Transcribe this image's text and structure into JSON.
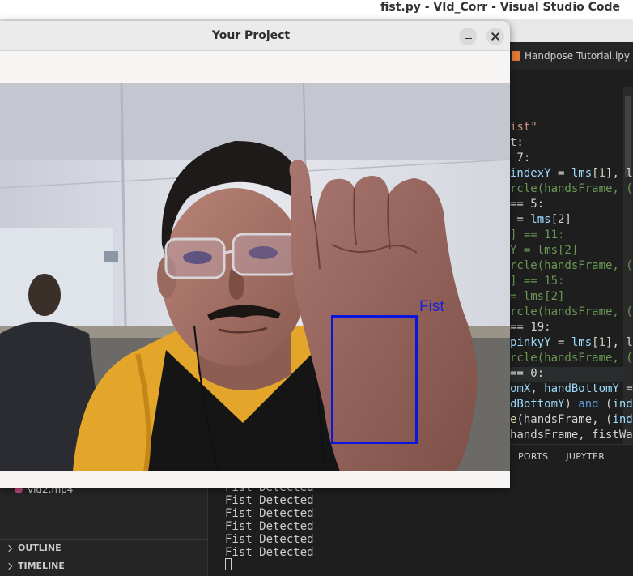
{
  "vscode": {
    "window_title": "fist.py - VId_Corr - Visual Studio Code",
    "tab_label": "Handpose Tutorial.ipy",
    "code_lines": [
      {
        "parts": [
          {
            "t": "ist\"",
            "c": "c-str"
          }
        ]
      },
      {
        "parts": [
          {
            "t": "t:",
            "c": "c-plain"
          }
        ]
      },
      {
        "parts": [
          {
            "t": " 7:",
            "c": "c-plain"
          }
        ]
      },
      {
        "parts": [
          {
            "t": "indexY",
            "c": "c-var"
          },
          {
            "t": " = ",
            "c": "c-plain"
          },
          {
            "t": "lms",
            "c": "c-var"
          },
          {
            "t": "[",
            "c": "c-plain"
          },
          {
            "t": "1",
            "c": "c-num"
          },
          {
            "t": "], l",
            "c": "c-plain"
          }
        ]
      },
      {
        "parts": [
          {
            "t": "rcle(handsFrame, (",
            "c": "c-cmt"
          }
        ]
      },
      {
        "parts": [
          {
            "t": "== 5:",
            "c": "c-plain"
          }
        ]
      },
      {
        "parts": [
          {
            "t": " = ",
            "c": "c-plain"
          },
          {
            "t": "lms",
            "c": "c-var"
          },
          {
            "t": "[2]",
            "c": "c-plain"
          }
        ]
      },
      {
        "parts": [
          {
            "t": "] == 11:",
            "c": "c-cmt"
          }
        ]
      },
      {
        "parts": [
          {
            "t": "Y = lms[2]",
            "c": "c-cmt"
          }
        ]
      },
      {
        "parts": [
          {
            "t": "rcle(handsFrame, (",
            "c": "c-cmt"
          }
        ]
      },
      {
        "parts": [
          {
            "t": "] == 15:",
            "c": "c-cmt"
          }
        ]
      },
      {
        "parts": [
          {
            "t": "= lms[2]",
            "c": "c-cmt"
          }
        ]
      },
      {
        "parts": [
          {
            "t": "rcle(handsFrame, (",
            "c": "c-cmt"
          }
        ]
      },
      {
        "parts": [
          {
            "t": "== 19:",
            "c": "c-plain"
          }
        ]
      },
      {
        "parts": [
          {
            "t": "pinkyY",
            "c": "c-var"
          },
          {
            "t": " = ",
            "c": "c-plain"
          },
          {
            "t": "lms",
            "c": "c-var"
          },
          {
            "t": "[",
            "c": "c-plain"
          },
          {
            "t": "1",
            "c": "c-num"
          },
          {
            "t": "], l",
            "c": "c-plain"
          }
        ]
      },
      {
        "parts": [
          {
            "t": "rcle(handsFrame, (",
            "c": "c-cmt"
          }
        ]
      },
      {
        "parts": [
          {
            "t": "== 0:",
            "c": "c-plain"
          }
        ]
      },
      {
        "parts": [
          {
            "t": "omX",
            "c": "c-var"
          },
          {
            "t": ", ",
            "c": "c-plain"
          },
          {
            "t": "handBottomY",
            "c": "c-var"
          },
          {
            "t": " =",
            "c": "c-plain"
          }
        ]
      },
      {
        "parts": [
          {
            "t": "dBottomY",
            "c": "c-var"
          },
          {
            "t": ") ",
            "c": "c-plain"
          },
          {
            "t": "and",
            "c": "c-kw"
          },
          {
            "t": " (",
            "c": "c-plain"
          },
          {
            "t": "ind",
            "c": "c-var"
          }
        ]
      },
      {
        "parts": [
          {
            "t": "e",
            "c": "c-fn"
          },
          {
            "t": "(handsFrame, (",
            "c": "c-plain"
          },
          {
            "t": "ind",
            "c": "c-var"
          }
        ]
      },
      {
        "parts": [
          {
            "t": "handsFrame, fistWa",
            "c": "c-plain"
          }
        ]
      }
    ],
    "panel_tabs": [
      "PORTS",
      "JUPYTER"
    ],
    "sidebar_file": "vid2.mp4",
    "sidebar_sections": [
      "OUTLINE",
      "TIMELINE"
    ],
    "terminal_lines": [
      "Fist Detected",
      "Fist Detected",
      "Fist Detected",
      "Fist Detected",
      "Fist Detected",
      "Fist Detected"
    ]
  },
  "project_window": {
    "title": "Your Project",
    "detection_label": "Fist",
    "detection_color": "#0a16e0"
  }
}
